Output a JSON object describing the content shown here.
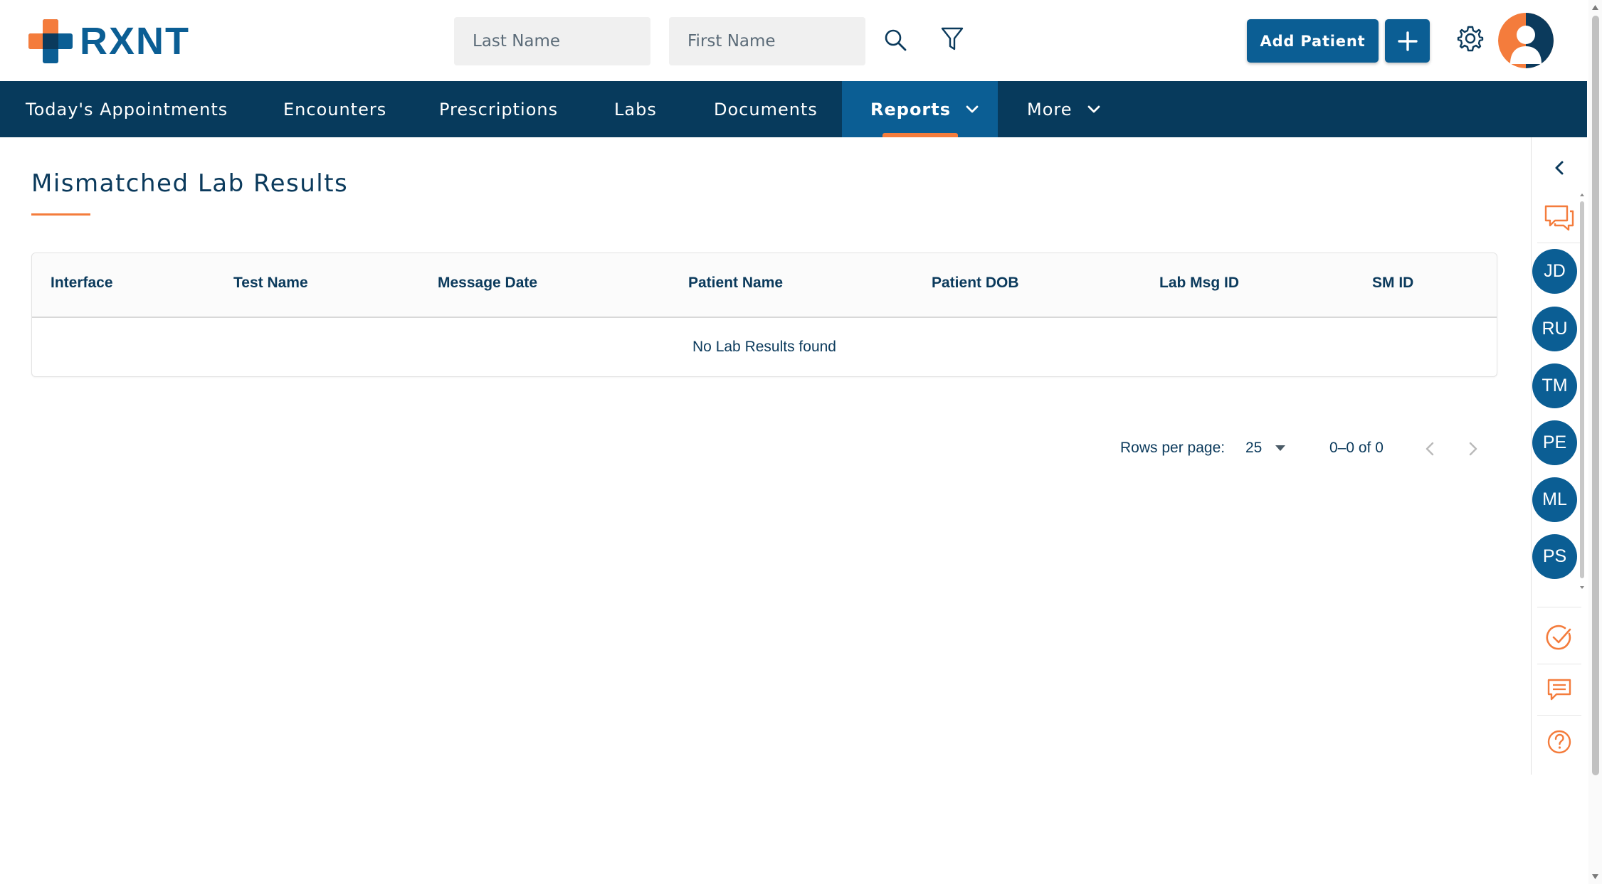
{
  "header": {
    "logo_text": "RXNT",
    "last_name_placeholder": "Last Name",
    "first_name_placeholder": "First Name",
    "add_patient_label": "Add Patient",
    "icons": [
      "search-icon",
      "filter-icon",
      "plus-icon",
      "gear-icon",
      "user-avatar-icon"
    ]
  },
  "nav": {
    "items": [
      {
        "label": "Today's Appointments"
      },
      {
        "label": "Encounters"
      },
      {
        "label": "Prescriptions"
      },
      {
        "label": "Labs"
      },
      {
        "label": "Documents"
      },
      {
        "label": "Reports",
        "active": true
      },
      {
        "label": "More"
      }
    ]
  },
  "page": {
    "title": "Mismatched Lab Results"
  },
  "table": {
    "columns": [
      "Interface",
      "Test Name",
      "Message Date",
      "Patient Name",
      "Patient DOB",
      "Lab Msg ID",
      "SM ID"
    ],
    "rows": [],
    "empty_message": "No Lab Results found"
  },
  "pagination": {
    "rows_per_page_label": "Rows per page:",
    "rows_per_page_value": "25",
    "range_text": "0–0 of 0"
  },
  "rail": {
    "chat_initials": [
      "JD",
      "RU",
      "TM",
      "PE",
      "ML",
      "PS"
    ],
    "icons": [
      "chevron-left-icon",
      "chat-bubbles-icon",
      "check-circle-icon",
      "message-icon",
      "help-circle-icon"
    ]
  },
  "colors": {
    "primary": "#0b5e94",
    "nav_bg": "#073a5c",
    "accent": "#f47c3c"
  }
}
